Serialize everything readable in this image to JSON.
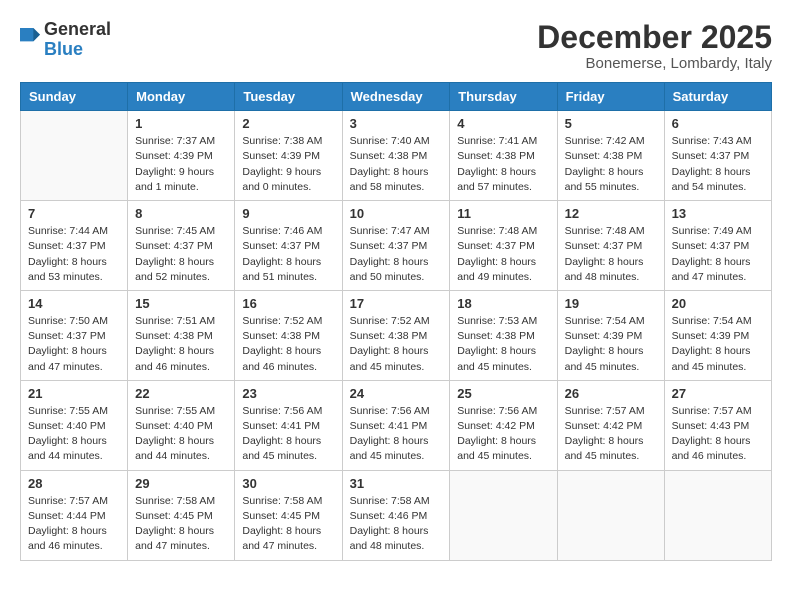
{
  "logo": {
    "general": "General",
    "blue": "Blue"
  },
  "title": {
    "month": "December 2025",
    "location": "Bonemerse, Lombardy, Italy"
  },
  "headers": [
    "Sunday",
    "Monday",
    "Tuesday",
    "Wednesday",
    "Thursday",
    "Friday",
    "Saturday"
  ],
  "weeks": [
    [
      {
        "day": "",
        "info": ""
      },
      {
        "day": "1",
        "info": "Sunrise: 7:37 AM\nSunset: 4:39 PM\nDaylight: 9 hours\nand 1 minute."
      },
      {
        "day": "2",
        "info": "Sunrise: 7:38 AM\nSunset: 4:39 PM\nDaylight: 9 hours\nand 0 minutes."
      },
      {
        "day": "3",
        "info": "Sunrise: 7:40 AM\nSunset: 4:38 PM\nDaylight: 8 hours\nand 58 minutes."
      },
      {
        "day": "4",
        "info": "Sunrise: 7:41 AM\nSunset: 4:38 PM\nDaylight: 8 hours\nand 57 minutes."
      },
      {
        "day": "5",
        "info": "Sunrise: 7:42 AM\nSunset: 4:38 PM\nDaylight: 8 hours\nand 55 minutes."
      },
      {
        "day": "6",
        "info": "Sunrise: 7:43 AM\nSunset: 4:37 PM\nDaylight: 8 hours\nand 54 minutes."
      }
    ],
    [
      {
        "day": "7",
        "info": "Sunrise: 7:44 AM\nSunset: 4:37 PM\nDaylight: 8 hours\nand 53 minutes."
      },
      {
        "day": "8",
        "info": "Sunrise: 7:45 AM\nSunset: 4:37 PM\nDaylight: 8 hours\nand 52 minutes."
      },
      {
        "day": "9",
        "info": "Sunrise: 7:46 AM\nSunset: 4:37 PM\nDaylight: 8 hours\nand 51 minutes."
      },
      {
        "day": "10",
        "info": "Sunrise: 7:47 AM\nSunset: 4:37 PM\nDaylight: 8 hours\nand 50 minutes."
      },
      {
        "day": "11",
        "info": "Sunrise: 7:48 AM\nSunset: 4:37 PM\nDaylight: 8 hours\nand 49 minutes."
      },
      {
        "day": "12",
        "info": "Sunrise: 7:48 AM\nSunset: 4:37 PM\nDaylight: 8 hours\nand 48 minutes."
      },
      {
        "day": "13",
        "info": "Sunrise: 7:49 AM\nSunset: 4:37 PM\nDaylight: 8 hours\nand 47 minutes."
      }
    ],
    [
      {
        "day": "14",
        "info": "Sunrise: 7:50 AM\nSunset: 4:37 PM\nDaylight: 8 hours\nand 47 minutes."
      },
      {
        "day": "15",
        "info": "Sunrise: 7:51 AM\nSunset: 4:38 PM\nDaylight: 8 hours\nand 46 minutes."
      },
      {
        "day": "16",
        "info": "Sunrise: 7:52 AM\nSunset: 4:38 PM\nDaylight: 8 hours\nand 46 minutes."
      },
      {
        "day": "17",
        "info": "Sunrise: 7:52 AM\nSunset: 4:38 PM\nDaylight: 8 hours\nand 45 minutes."
      },
      {
        "day": "18",
        "info": "Sunrise: 7:53 AM\nSunset: 4:38 PM\nDaylight: 8 hours\nand 45 minutes."
      },
      {
        "day": "19",
        "info": "Sunrise: 7:54 AM\nSunset: 4:39 PM\nDaylight: 8 hours\nand 45 minutes."
      },
      {
        "day": "20",
        "info": "Sunrise: 7:54 AM\nSunset: 4:39 PM\nDaylight: 8 hours\nand 45 minutes."
      }
    ],
    [
      {
        "day": "21",
        "info": "Sunrise: 7:55 AM\nSunset: 4:40 PM\nDaylight: 8 hours\nand 44 minutes."
      },
      {
        "day": "22",
        "info": "Sunrise: 7:55 AM\nSunset: 4:40 PM\nDaylight: 8 hours\nand 44 minutes."
      },
      {
        "day": "23",
        "info": "Sunrise: 7:56 AM\nSunset: 4:41 PM\nDaylight: 8 hours\nand 45 minutes."
      },
      {
        "day": "24",
        "info": "Sunrise: 7:56 AM\nSunset: 4:41 PM\nDaylight: 8 hours\nand 45 minutes."
      },
      {
        "day": "25",
        "info": "Sunrise: 7:56 AM\nSunset: 4:42 PM\nDaylight: 8 hours\nand 45 minutes."
      },
      {
        "day": "26",
        "info": "Sunrise: 7:57 AM\nSunset: 4:42 PM\nDaylight: 8 hours\nand 45 minutes."
      },
      {
        "day": "27",
        "info": "Sunrise: 7:57 AM\nSunset: 4:43 PM\nDaylight: 8 hours\nand 46 minutes."
      }
    ],
    [
      {
        "day": "28",
        "info": "Sunrise: 7:57 AM\nSunset: 4:44 PM\nDaylight: 8 hours\nand 46 minutes."
      },
      {
        "day": "29",
        "info": "Sunrise: 7:58 AM\nSunset: 4:45 PM\nDaylight: 8 hours\nand 47 minutes."
      },
      {
        "day": "30",
        "info": "Sunrise: 7:58 AM\nSunset: 4:45 PM\nDaylight: 8 hours\nand 47 minutes."
      },
      {
        "day": "31",
        "info": "Sunrise: 7:58 AM\nSunset: 4:46 PM\nDaylight: 8 hours\nand 48 minutes."
      },
      {
        "day": "",
        "info": ""
      },
      {
        "day": "",
        "info": ""
      },
      {
        "day": "",
        "info": ""
      }
    ]
  ]
}
